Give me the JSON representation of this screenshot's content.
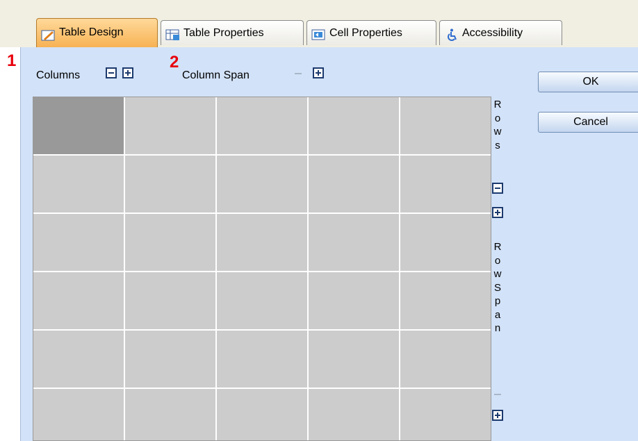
{
  "tabs": [
    {
      "label": "Table Design",
      "icon": "table-design-icon",
      "active": true
    },
    {
      "label": "Table Properties",
      "icon": "table-properties-icon",
      "active": false
    },
    {
      "label": "Cell Properties",
      "icon": "cell-properties-icon",
      "active": false
    },
    {
      "label": "Accessibility",
      "icon": "accessibility-icon",
      "active": false
    }
  ],
  "markers": {
    "one": "1",
    "two": "2"
  },
  "columns": {
    "label": "Columns"
  },
  "column_span": {
    "label": "Column Span"
  },
  "rows": {
    "letters": [
      "R",
      "o",
      "w",
      "s"
    ]
  },
  "row_span": {
    "letters": [
      "R",
      "o",
      "w",
      "S",
      "p",
      "a",
      "n"
    ]
  },
  "buttons": {
    "ok": "OK",
    "cancel": "Cancel"
  },
  "grid": {
    "rows": 6,
    "columns": 5,
    "selected_cell": [
      0,
      0
    ]
  },
  "colors": {
    "accent_tab": "#f7b254",
    "panel_bg": "#d2e2f8",
    "cell": "#cccccc",
    "selected_cell": "#999999",
    "marker": "#e8000b"
  }
}
